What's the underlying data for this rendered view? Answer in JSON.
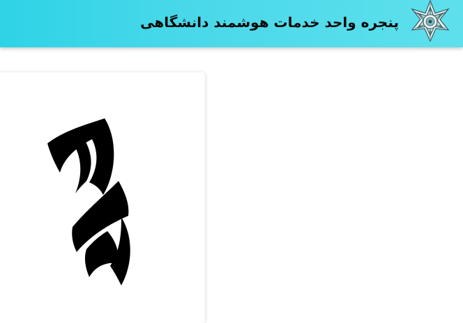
{
  "header": {
    "title": "پنجره واحد خدمات هوشمند دانشگاهی",
    "logo_icon": "ornament-star-icon",
    "background_color": "#3dd6e8"
  },
  "main": {
    "card_logo_icon": "university-calligraphy-logo-icon"
  }
}
